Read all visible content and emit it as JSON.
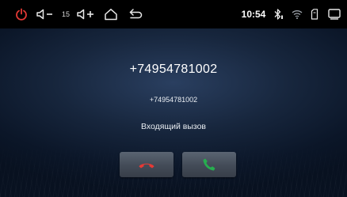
{
  "status_bar": {
    "volume_level": "15",
    "time": "10:54",
    "icons": [
      "power-icon",
      "volume-down-icon",
      "volume-up-icon",
      "home-icon",
      "back-icon",
      "bluetooth-icon",
      "wifi-icon",
      "sd-card-icon",
      "recent-apps-icon"
    ],
    "colors": {
      "power": "#e53935",
      "icon": "#e8e8e8"
    }
  },
  "call": {
    "caller_number": "+74954781002",
    "caller_number_secondary": "+74954781002",
    "status": "Входящий вызов"
  },
  "buttons": {
    "reject": {
      "icon": "phone-hangup-icon",
      "color": "#e53935"
    },
    "accept": {
      "icon": "phone-answer-icon",
      "color": "#27ae4f"
    }
  }
}
